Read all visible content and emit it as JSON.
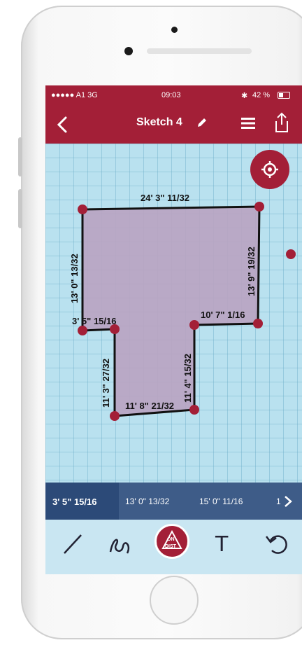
{
  "status_bar": {
    "carrier": "●●●●● A1  3G",
    "time": "09:03",
    "battery": "42 %"
  },
  "nav": {
    "title": "Sketch 4",
    "back_icon": "chevron-left-icon",
    "edit_icon": "pencil-icon",
    "menu_icon": "hamburger-menu-icon",
    "share_icon": "share-icon"
  },
  "sketch": {
    "labels": {
      "top": "24' 3\" 11/32",
      "left": "13' 0\" 13/32",
      "right": "13' 9\" 19/32",
      "mid_left": "3' 5\" 15/16",
      "mid_right": "10' 7\" 1/16",
      "bottom_left": "11' 3\" 27/32",
      "inner_right": "11' 4\" 15/32",
      "bottom": "11' 8\" 21/32"
    },
    "fill_color": "#b9a3c1",
    "vertex_color": "#a31f37"
  },
  "measurements": {
    "items": [
      "3' 5\" 15/16",
      "13' 0\" 13/32",
      "15' 0\" 11/16",
      "1"
    ],
    "next_icon": "chevron-right-icon"
  },
  "toolbar": {
    "disto_label_top": "ON",
    "disto_label_bottom": "DIST",
    "text_tool": "T"
  },
  "colors": {
    "accent": "#a31f37",
    "grid_bg": "#b9e1ef",
    "meas_bar": "#3e5c88"
  }
}
